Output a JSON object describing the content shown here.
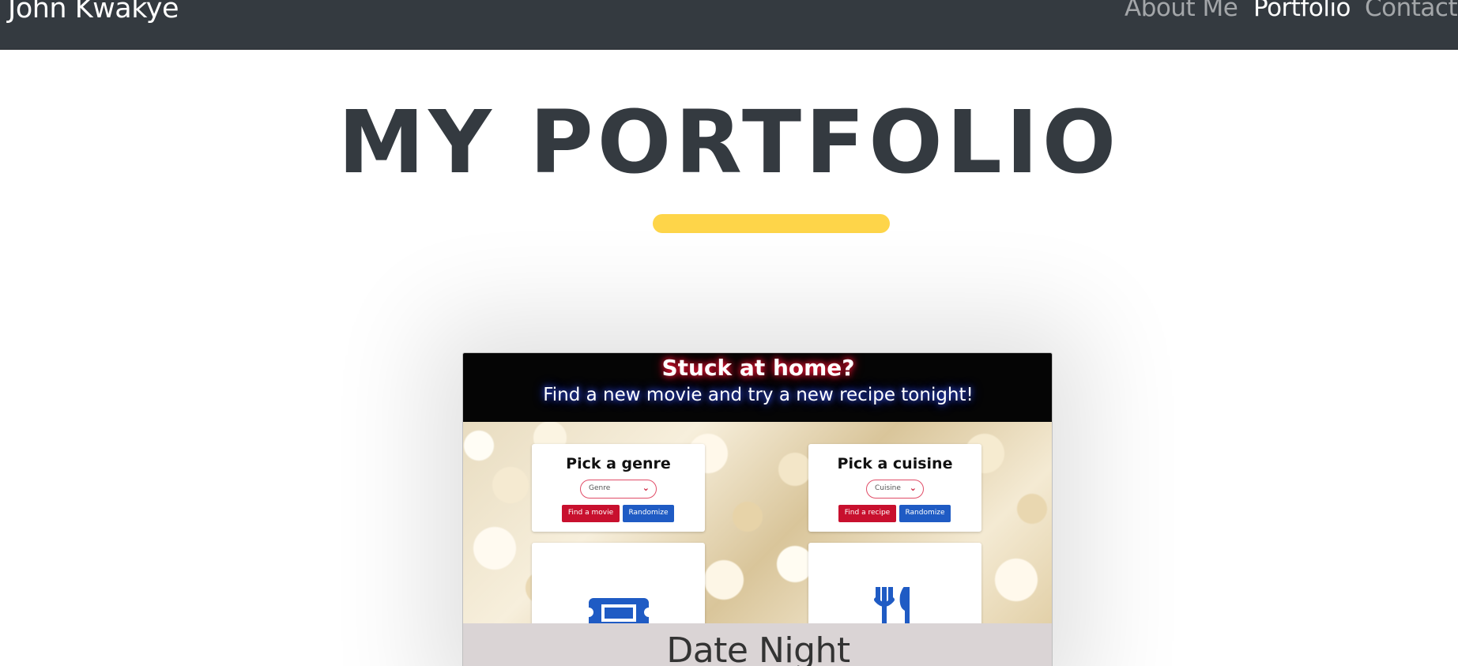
{
  "navbar": {
    "brand": "John Kwakye",
    "links": [
      {
        "label": "About Me",
        "active": false
      },
      {
        "label": "Portfolio",
        "active": true
      },
      {
        "label": "Contact",
        "active": false
      }
    ]
  },
  "main": {
    "title": "MY PORTFOLIO",
    "divider_color": "#fed549"
  },
  "project": {
    "screenshot": {
      "headline": "Stuck at home?",
      "subheadline": "Find a new movie and try a new recipe tonight!",
      "genre_card": {
        "title": "Pick a genre",
        "select_value": "Genre",
        "primary_button": "Find a movie",
        "secondary_button": "Randomize"
      },
      "cuisine_card": {
        "title": "Pick a cuisine",
        "select_value": "Cuisine",
        "primary_button": "Find a recipe",
        "secondary_button": "Randomize"
      },
      "icons": [
        "ticket-icon",
        "fork-knife-icon"
      ]
    },
    "title": "Date Night"
  },
  "colors": {
    "navbar_bg": "#343a40",
    "accent_yellow": "#fed549",
    "button_red": "#c8102e",
    "button_blue": "#1f5bc4"
  }
}
